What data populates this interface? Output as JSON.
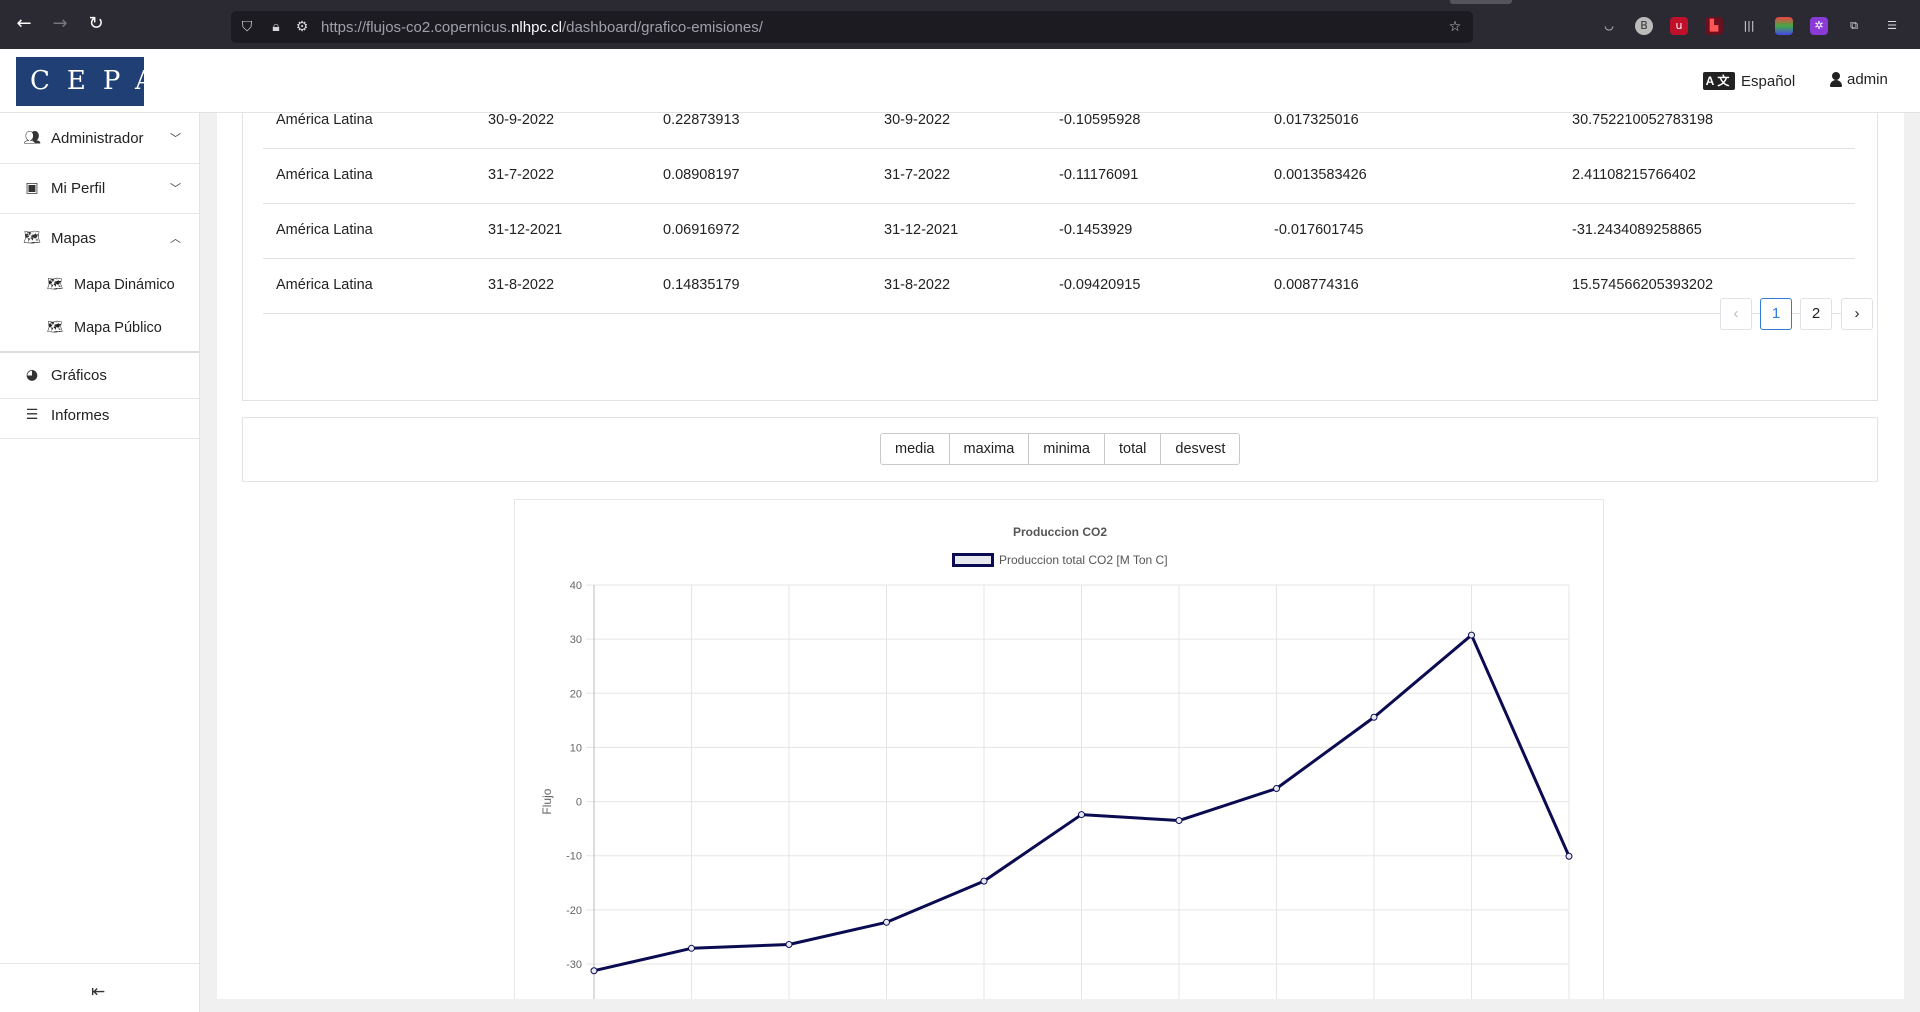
{
  "browser": {
    "url_prefix": "https://flujos-co2.copernicus.",
    "url_domain": "nlhpc.cl",
    "url_path": "/dashboard/grafico-emisiones/"
  },
  "header": {
    "logo": "CEPAL",
    "language": "Español",
    "user": "admin"
  },
  "sidebar": {
    "items": [
      {
        "label": "Administrador",
        "icon": "users-cog-icon"
      },
      {
        "label": "Mi Perfil",
        "icon": "id-badge-icon"
      },
      {
        "label": "Mapas",
        "icon": "map-icon"
      },
      {
        "label": "Mapa Dinámico",
        "icon": "map-icon"
      },
      {
        "label": "Mapa Público",
        "icon": "map-icon"
      },
      {
        "label": "Gráficos",
        "icon": "chart-pie-icon"
      },
      {
        "label": "Informes",
        "icon": "list-icon"
      }
    ]
  },
  "table": {
    "rows": [
      [
        "América Latina",
        "30-9-2022",
        "0.22873913",
        "30-9-2022",
        "-0.10595928",
        "0.017325016",
        "30.752210052783198"
      ],
      [
        "América Latina",
        "31-7-2022",
        "0.08908197",
        "31-7-2022",
        "-0.11176091",
        "0.0013583426",
        "2.41108215766402"
      ],
      [
        "América Latina",
        "31-12-2021",
        "0.06916972",
        "31-12-2021",
        "-0.1453929",
        "-0.017601745",
        "-31.2434089258865"
      ],
      [
        "América Latina",
        "31-8-2022",
        "0.14835179",
        "31-8-2022",
        "-0.09420915",
        "0.008774316",
        "15.574566205393202"
      ]
    ],
    "pagination": {
      "prev": "‹",
      "pages": [
        "1",
        "2"
      ],
      "next": "›",
      "active": "1"
    }
  },
  "stat_buttons": [
    "media",
    "maxima",
    "minima",
    "total",
    "desvest"
  ],
  "chart_data": {
    "type": "line",
    "title": "Produccion CO2",
    "ylabel": "Flujo",
    "xlabel": "",
    "ylim": [
      -30,
      40
    ],
    "yticks": [
      40,
      30,
      20,
      10,
      0,
      -10,
      -20,
      -30
    ],
    "grid": true,
    "legend_position": "top",
    "series": [
      {
        "name": "Produccion total CO2 [M Ton C]",
        "color": "#0b0b52",
        "values": [
          -31.24,
          -27.1,
          -26.4,
          -22.3,
          -14.7,
          -2.4,
          -3.5,
          2.41,
          15.57,
          30.75,
          -10.1
        ]
      }
    ]
  }
}
